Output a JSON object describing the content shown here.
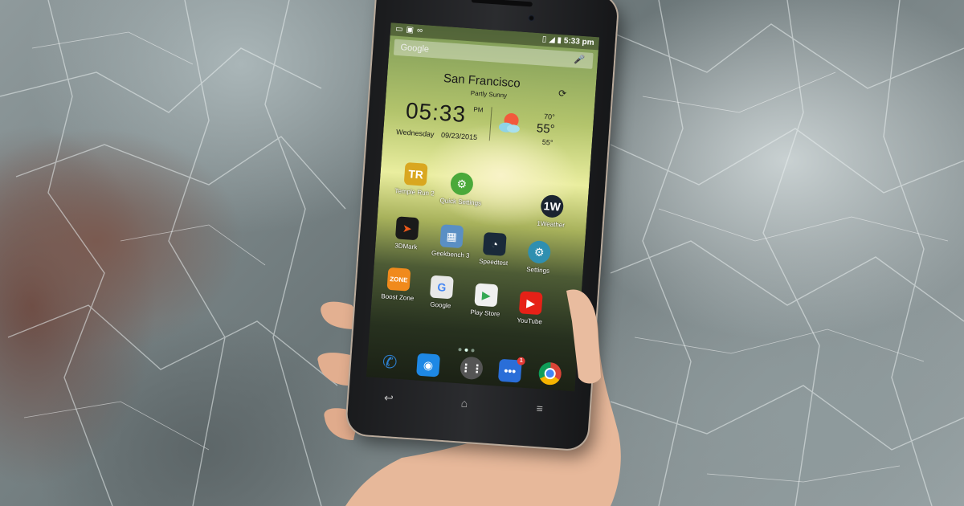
{
  "statusbar": {
    "left_icons": [
      "message-icon",
      "photo-icon",
      "voicemail-icon"
    ],
    "right_icons": [
      "vibrate-icon",
      "signal-icon",
      "battery-icon"
    ],
    "time": "5:33 pm"
  },
  "search": {
    "label": "Google",
    "mic_icon": "microphone-icon"
  },
  "weather": {
    "city": "San Francisco",
    "condition": "Partly Sunny",
    "time": "05:33",
    "ampm": "PM",
    "day": "Wednesday",
    "date": "09/23/2015",
    "high": "70°",
    "current": "55°",
    "low": "55°",
    "icon": "partly-sunny-icon"
  },
  "apps": [
    {
      "label": "Temple Run 2",
      "icon": "temple-run-icon",
      "color": "#d9a720"
    },
    {
      "label": "Quick Settings",
      "icon": "gear-icon",
      "color": "#4aa93a"
    },
    {
      "label": "1Weather",
      "icon": "weather-icon",
      "color": "#1b2430"
    },
    {
      "label": "3DMark",
      "icon": "3dmark-icon",
      "color": "#1a1a1a"
    },
    {
      "label": "Geekbench 3",
      "icon": "geekbench-icon",
      "color": "#5a8fc4"
    },
    {
      "label": "Speedtest",
      "icon": "speedometer-icon",
      "color": "#1a2a3a"
    },
    {
      "label": "Settings",
      "icon": "settings-gear-icon",
      "color": "#2f8fb0"
    },
    {
      "label": "Boost Zone",
      "icon": "boost-zone-icon",
      "color": "#f08a1c"
    },
    {
      "label": "Google",
      "icon": "google-icon",
      "color": "#e8e8e8"
    },
    {
      "label": "Play Store",
      "icon": "play-store-icon",
      "color": "#f0f0f0"
    },
    {
      "label": "YouTube",
      "icon": "youtube-icon",
      "color": "#e62117"
    }
  ],
  "dock": [
    {
      "icon": "phone-icon",
      "color": "#2d7fd0"
    },
    {
      "icon": "camera-icon",
      "color": "#1e88e5"
    },
    {
      "icon": "app-drawer-icon",
      "color": "#555555"
    },
    {
      "icon": "messaging-icon",
      "color": "#2a6ed8"
    },
    {
      "icon": "chrome-icon",
      "color": "#e0e0e0"
    }
  ],
  "notification_badge": "1",
  "navbar": [
    "back-icon",
    "home-icon",
    "menu-icon"
  ]
}
